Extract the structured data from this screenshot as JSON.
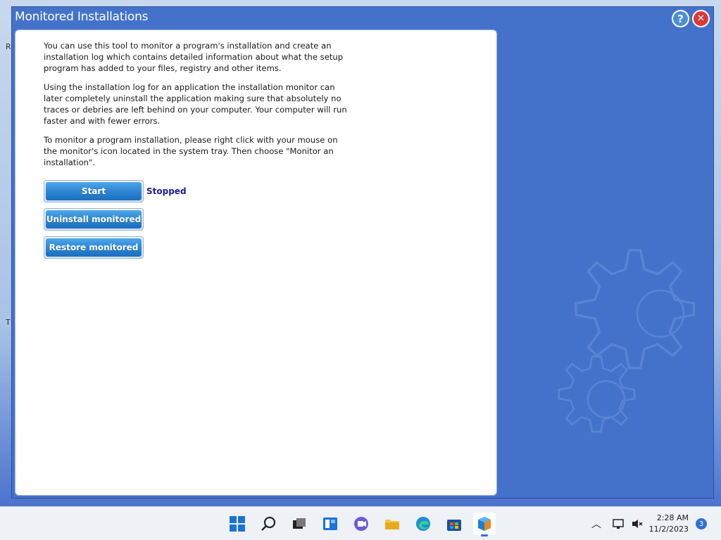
{
  "window": {
    "title": "Monitored Installations",
    "help_glyph": "?",
    "close_glyph": "✕"
  },
  "main": {
    "paragraphs": [
      "You can use this tool to monitor a program's installation and create an installation log which contains detailed information about what the setup program has added to your files, registry and other items.",
      "Using the installation log for an application the installation monitor can later completely uninstall the application making sure that absolutely no traces or debries are left behind on your computer. Your computer will run faster and with fewer errors.",
      "To monitor a program installation, please right click with your mouse on the monitor's icon located in the system tray. Then choose \"Monitor an installation\"."
    ],
    "buttons": {
      "start": "Start",
      "uninstall": "Uninstall monitored",
      "restore": "Restore monitored"
    },
    "status": "Stopped"
  },
  "taskbar": {
    "items": [
      "start-icon",
      "search-icon",
      "task-view-icon",
      "widgets-icon",
      "chat-icon",
      "file-explorer-icon",
      "edge-icon",
      "store-icon",
      "app-cube-icon"
    ],
    "clock_time": "2:28 AM",
    "clock_date": "11/2/2023",
    "notification_count": "3"
  },
  "colors": {
    "window_bg": "#4472cb",
    "button_blue": "#2e86d4",
    "status_text": "#1b1b9a",
    "close_red": "#d83a3a"
  }
}
